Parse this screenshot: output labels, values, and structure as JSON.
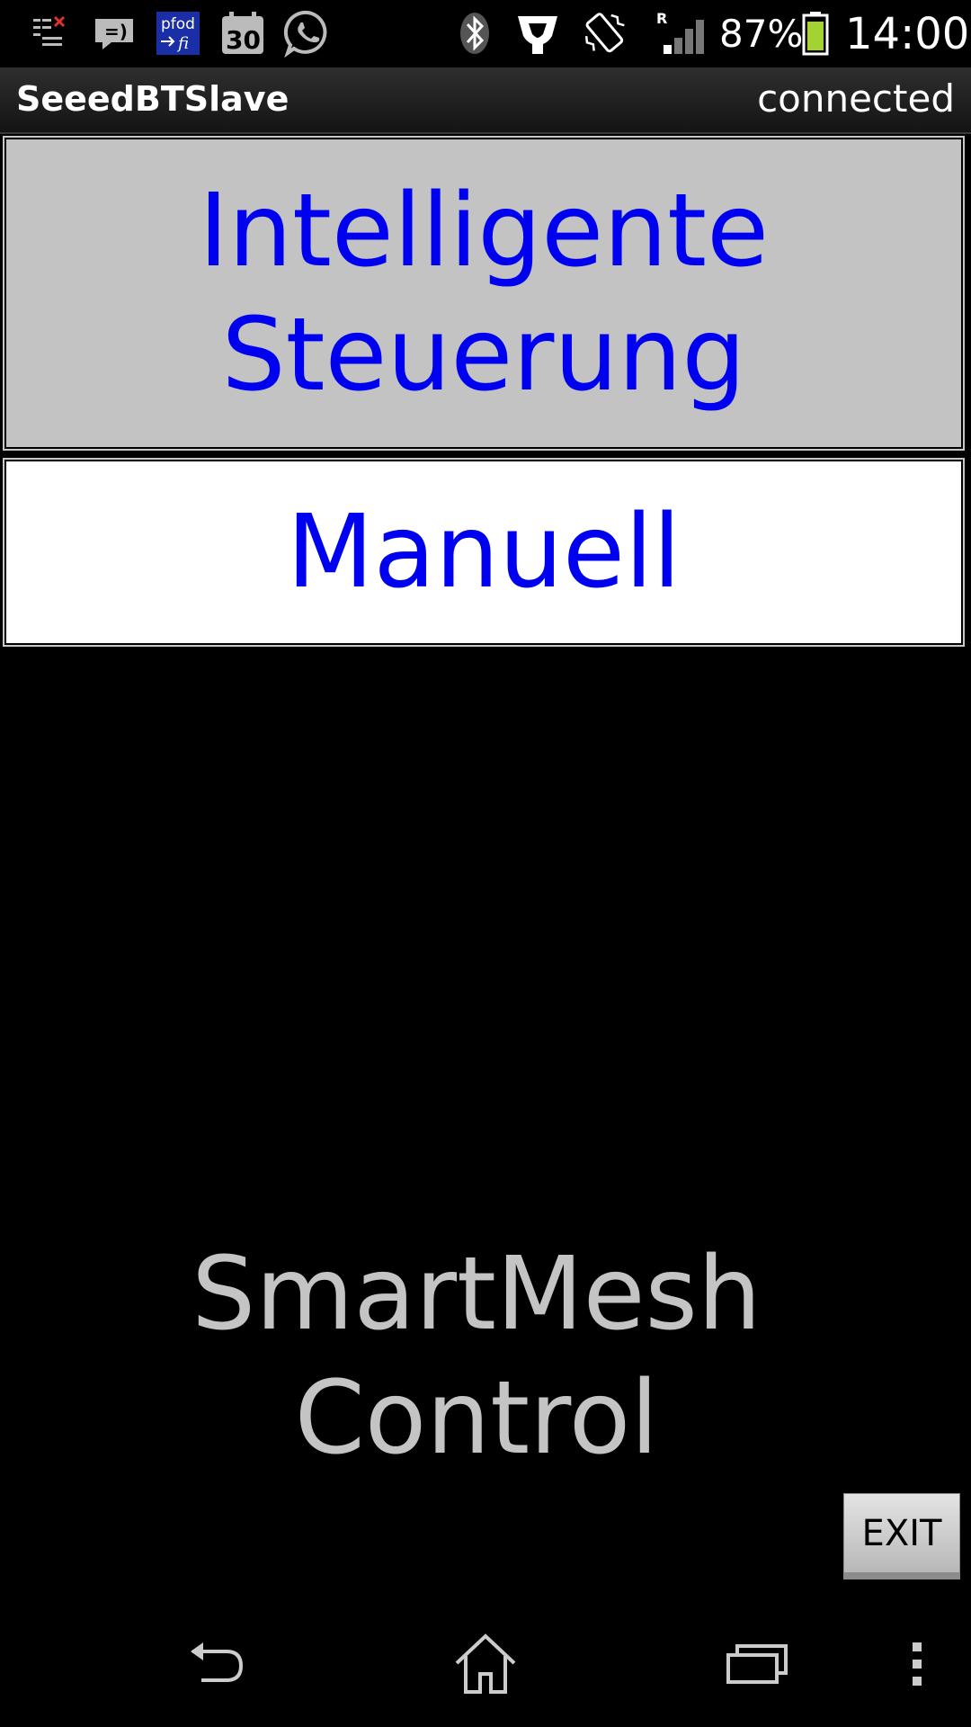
{
  "status_bar": {
    "notification_icons": [
      "task-list-icon",
      "chat-bubble-icon",
      "pfodfi-app-icon",
      "calendar-icon",
      "whatsapp-icon"
    ],
    "pfod_icon_text": "pfod",
    "pfod_icon_text2": "fi",
    "calendar_day": "30",
    "system_icons": [
      "bluetooth-icon",
      "nfc-icon",
      "vibrate-icon",
      "signal-icon",
      "battery-icon"
    ],
    "roaming_indicator": "R",
    "battery_percent": "87%",
    "time": "14:00",
    "battery_color": "#a4d233"
  },
  "action_bar": {
    "title": "SeeedBTSlave",
    "connection_status": "connected"
  },
  "menu": {
    "items": [
      {
        "label_line1": "Intelligente",
        "label_line2": "Steuerung",
        "background": "#c3c3c3"
      },
      {
        "label": "Manuell",
        "background": "#ffffff"
      }
    ],
    "text_color": "#0000f0"
  },
  "center_label": {
    "line1": "SmartMesh",
    "line2": "Control"
  },
  "exit_button": {
    "label": "EXIT"
  },
  "nav_bar": {
    "buttons": [
      "back-icon",
      "home-icon",
      "recent-apps-icon",
      "overflow-menu-icon"
    ]
  }
}
